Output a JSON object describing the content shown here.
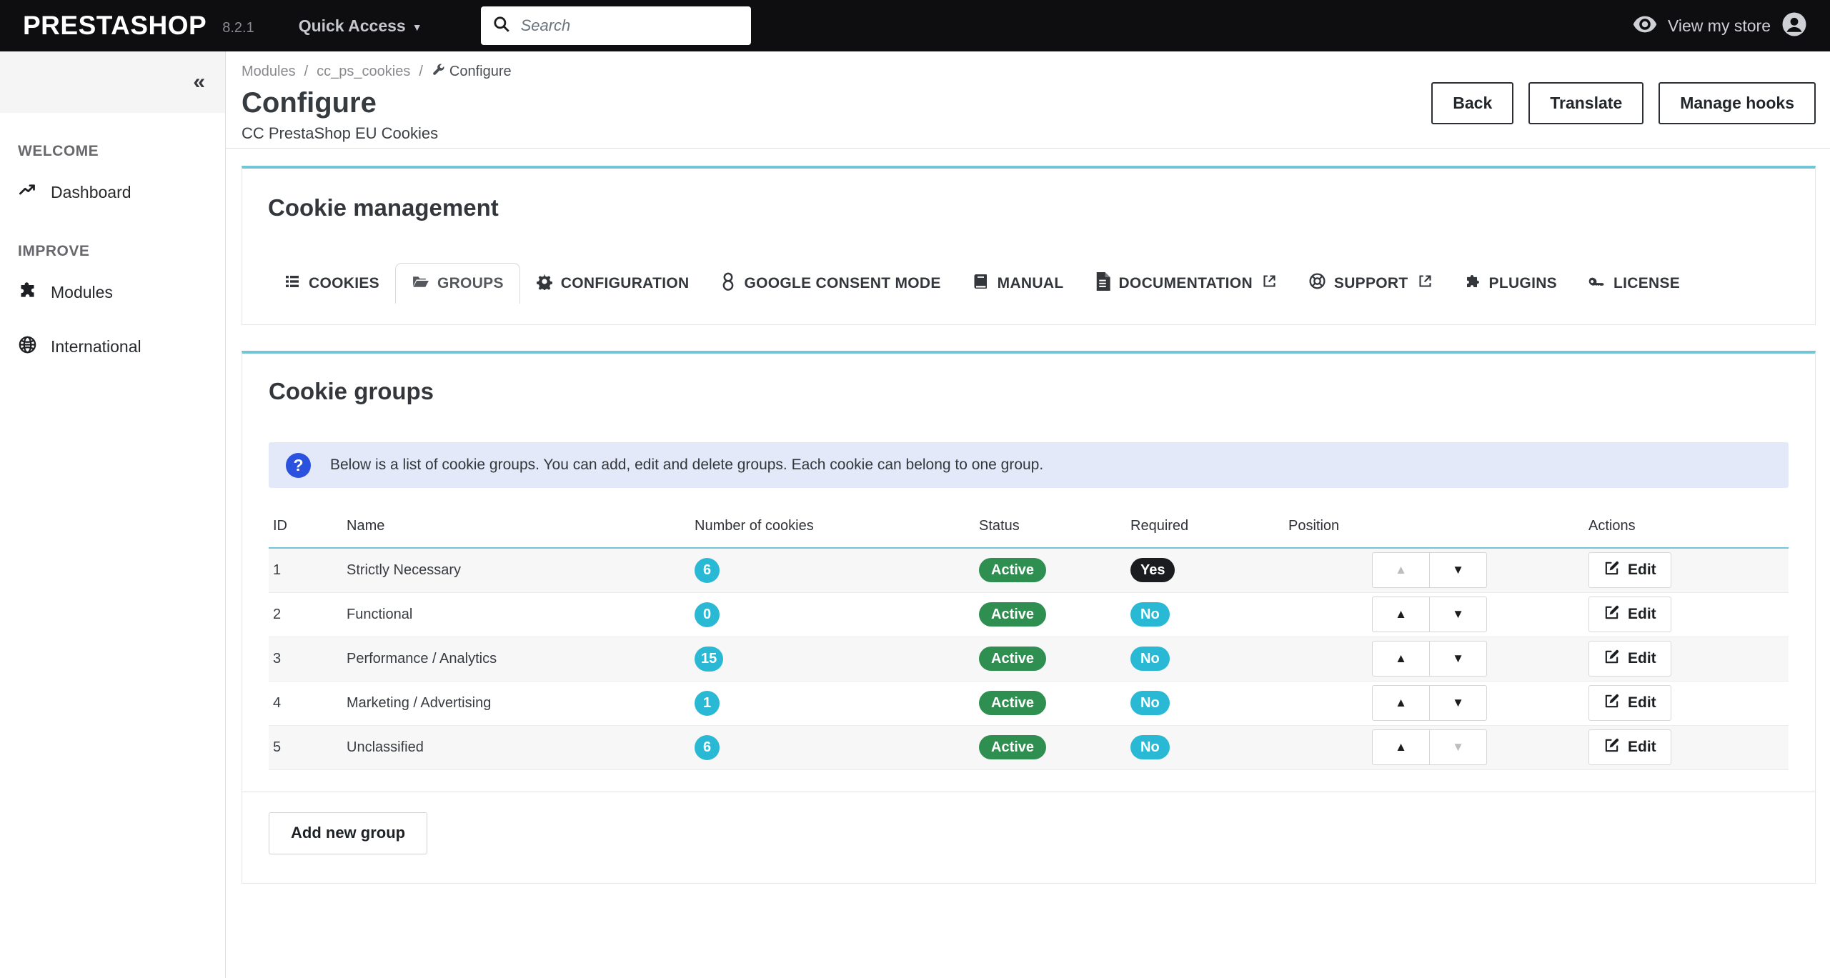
{
  "topbar": {
    "logo": "PRESTASHOP",
    "version": "8.2.1",
    "quick_access": "Quick Access",
    "search_placeholder": "Search",
    "view_store": "View my store"
  },
  "sidebar": {
    "sections": [
      {
        "label": "WELCOME",
        "items": [
          {
            "label": "Dashboard",
            "icon": "trending-up-icon"
          }
        ]
      },
      {
        "label": "IMPROVE",
        "items": [
          {
            "label": "Modules",
            "icon": "puzzle-icon"
          },
          {
            "label": "International",
            "icon": "globe-icon"
          }
        ]
      }
    ]
  },
  "page_header": {
    "breadcrumb": {
      "items": [
        "Modules",
        "cc_ps_cookies"
      ],
      "current": "Configure"
    },
    "title": "Configure",
    "subtitle": "CC PrestaShop EU Cookies",
    "actions": {
      "back": "Back",
      "translate": "Translate",
      "manage_hooks": "Manage hooks"
    }
  },
  "cookie_management": {
    "title": "Cookie management",
    "tabs": [
      {
        "label": "COOKIES",
        "icon": "list-icon",
        "active": false
      },
      {
        "label": "GROUPS",
        "icon": "folder-icon",
        "active": true
      },
      {
        "label": "CONFIGURATION",
        "icon": "gear-icon",
        "active": false
      },
      {
        "label": "GOOGLE CONSENT MODE",
        "icon": "google-icon",
        "active": false
      },
      {
        "label": "MANUAL",
        "icon": "book-icon",
        "active": false
      },
      {
        "label": "DOCUMENTATION",
        "icon": "document-icon",
        "external": true,
        "active": false
      },
      {
        "label": "SUPPORT",
        "icon": "life-ring-icon",
        "external": true,
        "active": false
      },
      {
        "label": "PLUGINS",
        "icon": "plugin-icon",
        "active": false
      },
      {
        "label": "LICENSE",
        "icon": "key-icon",
        "active": false
      }
    ]
  },
  "cookie_groups": {
    "title": "Cookie groups",
    "info": "Below is a list of cookie groups. You can add, edit and delete groups. Each cookie can belong to one group.",
    "table": {
      "headers": [
        "ID",
        "Name",
        "Number of cookies",
        "Status",
        "Required",
        "Position",
        "Actions"
      ],
      "edit_label": "Edit",
      "rows": [
        {
          "id": "1",
          "name": "Strictly Necessary",
          "cookies": "6",
          "status": "Active",
          "required": "Yes",
          "up_disabled": true,
          "down_disabled": false
        },
        {
          "id": "2",
          "name": "Functional",
          "cookies": "0",
          "status": "Active",
          "required": "No",
          "up_disabled": false,
          "down_disabled": false
        },
        {
          "id": "3",
          "name": "Performance / Analytics",
          "cookies": "15",
          "status": "Active",
          "required": "No",
          "up_disabled": false,
          "down_disabled": false
        },
        {
          "id": "4",
          "name": "Marketing / Advertising",
          "cookies": "1",
          "status": "Active",
          "required": "No",
          "up_disabled": false,
          "down_disabled": false
        },
        {
          "id": "5",
          "name": "Unclassified",
          "cookies": "6",
          "status": "Active",
          "required": "No",
          "up_disabled": false,
          "down_disabled": true
        }
      ]
    },
    "add_button": "Add new group"
  },
  "colors": {
    "topbar_bg": "#0e0e10",
    "panel_accent_teal": "#74c4d7",
    "badge_cyan": "#29b9d5",
    "badge_green": "#2e8f51",
    "badge_black": "#1b1c1f",
    "alert_bg": "#e4e9fa",
    "alert_icon_blue": "#2b51df"
  }
}
